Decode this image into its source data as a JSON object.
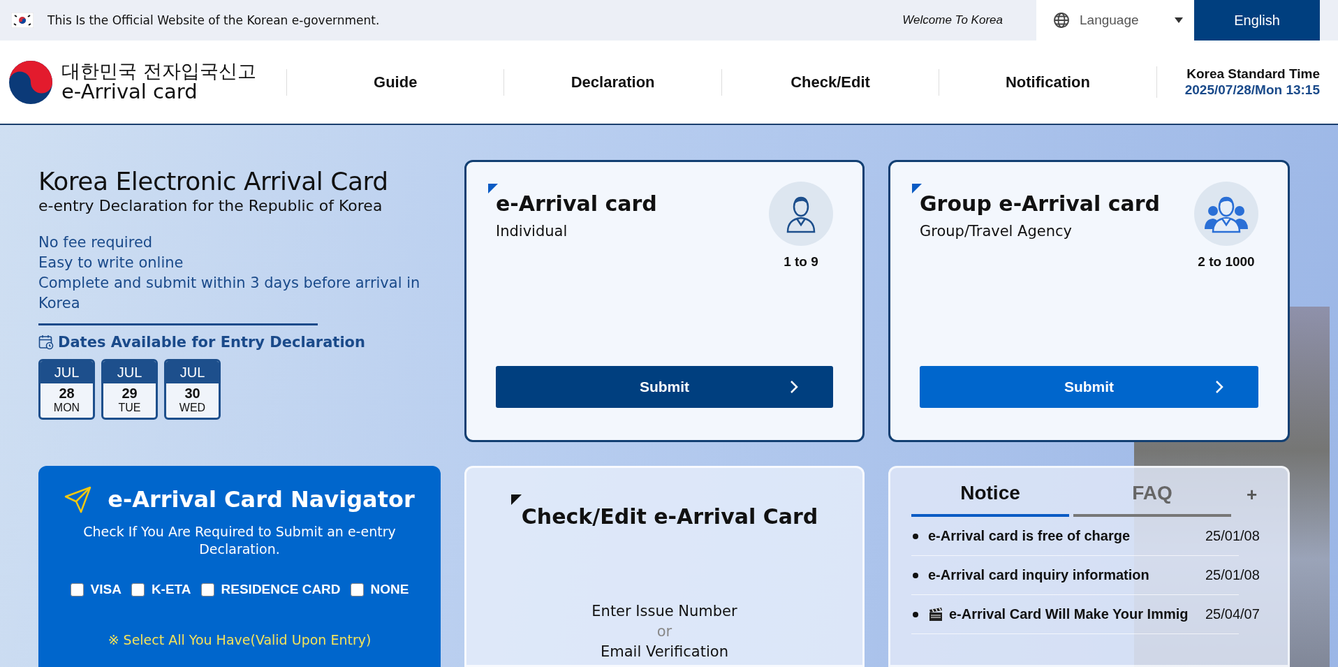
{
  "gov_bar": {
    "notice": "This Is the Official Website of the Korean e-government.",
    "welcome": "Welcome To Korea",
    "language_label": "Language",
    "language_value": "English"
  },
  "header": {
    "logo_korean": "대한민국 전자입국신고",
    "logo_english": "e-Arrival card",
    "nav": [
      {
        "label": "Guide"
      },
      {
        "label": "Declaration"
      },
      {
        "label": "Check/Edit"
      },
      {
        "label": "Notification"
      }
    ],
    "time_label": "Korea Standard Time",
    "time_value": "2025/07/28/Mon 13:15"
  },
  "intro": {
    "title": "Korea Electronic Arrival Card",
    "subtitle": "e-entry Declaration for the Republic of Korea",
    "points": [
      "No fee required",
      "Easy to write online",
      "Complete and submit within 3 days before arrival in Korea"
    ],
    "dates_heading": "Dates Available for Entry Declaration",
    "dates": [
      {
        "month": "JUL",
        "day": "28",
        "weekday": "MON"
      },
      {
        "month": "JUL",
        "day": "29",
        "weekday": "TUE"
      },
      {
        "month": "JUL",
        "day": "30",
        "weekday": "WED"
      }
    ]
  },
  "cards": [
    {
      "kind": "individual",
      "title": "e-Arrival card",
      "subtitle": "Individual",
      "range": "1 to 9",
      "button": "Submit"
    },
    {
      "kind": "group",
      "title": "Group e-Arrival card",
      "subtitle": "Group/Travel Agency",
      "range": "2 to 1000",
      "button": "Submit"
    }
  ],
  "navigator": {
    "title": "e-Arrival Card Navigator",
    "description": "Check If You Are Required to Submit an e-entry Declaration.",
    "options": [
      {
        "label": "VISA",
        "checked": false
      },
      {
        "label": "K-ETA",
        "checked": false
      },
      {
        "label": "RESIDENCE CARD",
        "checked": false
      },
      {
        "label": "NONE",
        "checked": false
      }
    ],
    "hint": "※ Select All You Have(Valid Upon Entry)"
  },
  "check_edit": {
    "title": "Check/Edit e-Arrival Card",
    "line_1": "Enter Issue Number",
    "separator": "or",
    "line_2": "Email Verification"
  },
  "board": {
    "tabs": [
      {
        "label": "Notice",
        "selected": true
      },
      {
        "label": "FAQ",
        "selected": false
      }
    ],
    "more": "+",
    "items": [
      {
        "kind": "text",
        "title": "e-Arrival card is free of charge",
        "date": "25/01/08"
      },
      {
        "kind": "text",
        "title": "e-Arrival card inquiry information",
        "date": "25/01/08"
      },
      {
        "kind": "video",
        "title": "e-Arrival Card Will Make Your Immig",
        "date": "25/04/07"
      }
    ]
  }
}
